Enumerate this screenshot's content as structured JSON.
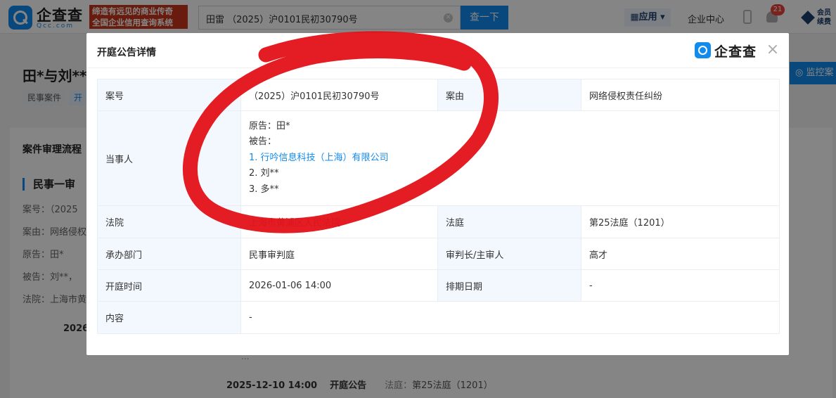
{
  "header": {
    "logo_text": "企查查",
    "logo_sub": "Qcc.com",
    "slogan_line1": "缔造有远见的商业传奇",
    "slogan_line2": "全国企业信用查询系统",
    "search_value": "田雷 （2025）沪0101民初30790号",
    "search_button": "查一下",
    "apps_label": "应用",
    "enterprise_center": "企业中心",
    "notification_count": "21",
    "vip_line1": "会员",
    "vip_line2": "续费"
  },
  "background": {
    "title": "田*与刘**",
    "tags": [
      "民事案件",
      "开"
    ],
    "monitor_button": "监控案",
    "section_title": "案件审理流程",
    "stage_title": "民事一审",
    "lines": [
      "案号：（2025",
      "案由：网络侵权",
      "原告：田*",
      "被告：刘**，",
      "法院：上海市黄"
    ],
    "date1": "2026",
    "mid_text": "...",
    "bottom_date": "2025-12-10 14:00",
    "bottom_type": "开庭公告",
    "bottom_court_label": "法庭：",
    "bottom_court_value": "第25法庭（1201）"
  },
  "modal": {
    "title": "开庭公告详情",
    "logo_text": "企查查",
    "close_symbol": "×",
    "rows": {
      "case_no_label": "案号",
      "case_no_value": "（2025）沪0101民初30790号",
      "cause_label": "案由",
      "cause_value": "网络侵权责任纠纷",
      "parties_label": "当事人",
      "plaintiff": "原告：田*",
      "defendant_label": "被告：",
      "defendant_1": "1. 行吟信息科技（上海）有限公司",
      "defendant_2": "2. 刘**",
      "defendant_3": "3. 多**",
      "court_label": "法院",
      "court_value": "上海市黄浦区人民法院",
      "courtroom_label": "法庭",
      "courtroom_value": "第25法庭（1201）",
      "department_label": "承办部门",
      "department_value": "民事审判庭",
      "judge_label": "审判长/主审人",
      "judge_value": "高才",
      "hearing_time_label": "开庭时间",
      "hearing_time_value": "2026-01-06 14:00",
      "schedule_label": "排期日期",
      "schedule_value": "-",
      "content_label": "内容",
      "content_value": "-"
    }
  },
  "colors": {
    "accent": "#128bed",
    "slogan_bg": "#c9361a",
    "annotation": "#e3141b",
    "label_bg": "#f2f8fe"
  }
}
